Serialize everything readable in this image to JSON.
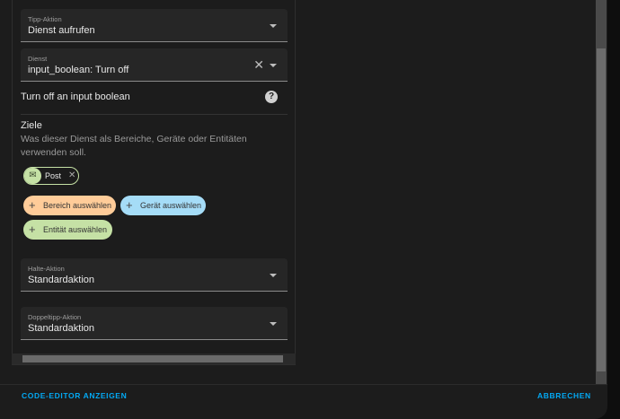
{
  "tap_action": {
    "label": "Tipp-Aktion",
    "value": "Dienst aufrufen"
  },
  "service": {
    "label": "Dienst",
    "value": "input_boolean: Turn off"
  },
  "service_description": "Turn off an input boolean",
  "targets": {
    "title": "Ziele",
    "description": "Was dieser Dienst als Bereiche, Geräte oder Entitäten verwenden soll.",
    "chips": [
      {
        "label": "Post",
        "icon": "mail-icon",
        "color": "#c5e1a5"
      }
    ],
    "add_buttons": [
      {
        "label": "Bereich auswählen",
        "color": "#ffcc99"
      },
      {
        "label": "Gerät auswählen",
        "color": "#a5dcf7"
      },
      {
        "label": "Entität auswählen",
        "color": "#c5e1a5"
      }
    ]
  },
  "hold_action": {
    "label": "Halte-Aktion",
    "value": "Standardaktion"
  },
  "double_tap_action": {
    "label": "Doppeltipp-Aktion",
    "value": "Standardaktion"
  },
  "footer": {
    "code_editor": "CODE-EDITOR ANZEIGEN",
    "cancel": "ABBRECHEN"
  },
  "accent": "#03a9f4"
}
